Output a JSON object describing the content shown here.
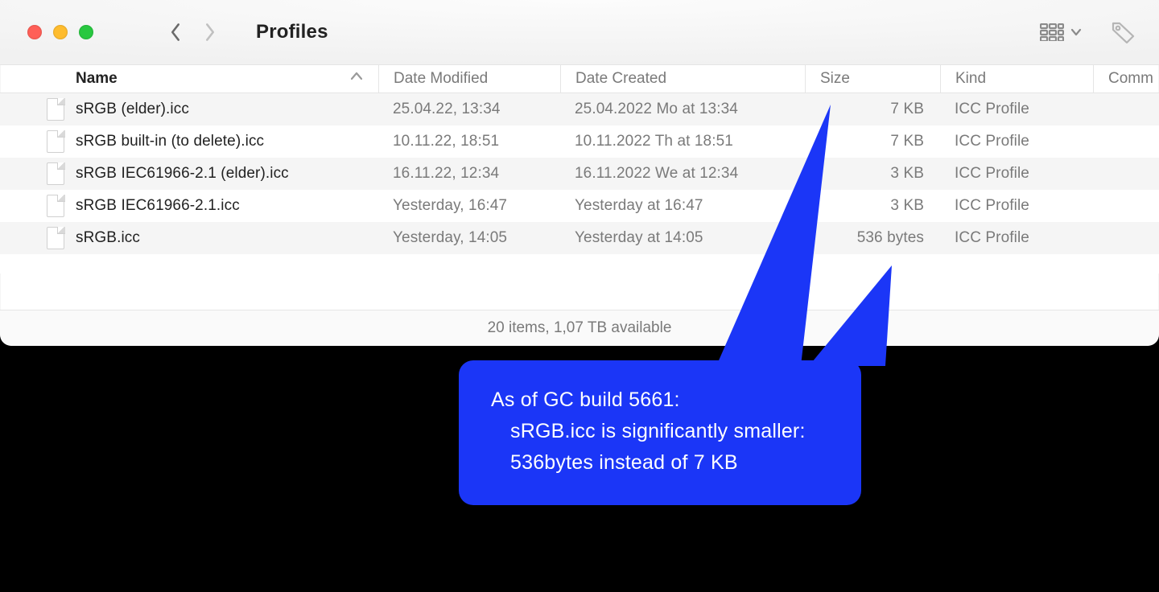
{
  "window": {
    "title": "Profiles"
  },
  "columns": {
    "name": "Name",
    "modified": "Date Modified",
    "created": "Date Created",
    "size": "Size",
    "kind": "Kind",
    "comments": "Comm"
  },
  "rows": [
    {
      "name": "sRGB (elder).icc",
      "modified": "25.04.22, 13:34",
      "created": "25.04.2022 Mo at 13:34",
      "size": "7 KB",
      "kind": "ICC Profile"
    },
    {
      "name": "sRGB built-in (to delete).icc",
      "modified": "10.11.22, 18:51",
      "created": "10.11.2022 Th at 18:51",
      "size": "7 KB",
      "kind": "ICC Profile"
    },
    {
      "name": "sRGB IEC61966-2.1 (elder).icc",
      "modified": "16.11.22, 12:34",
      "created": "16.11.2022 We at 12:34",
      "size": "3 KB",
      "kind": "ICC Profile"
    },
    {
      "name": "sRGB IEC61966-2.1.icc",
      "modified": "Yesterday, 16:47",
      "created": "Yesterday at 16:47",
      "size": "3 KB",
      "kind": "ICC Profile"
    },
    {
      "name": "sRGB.icc",
      "modified": "Yesterday, 14:05",
      "created": "Yesterday at 14:05",
      "size": "536 bytes",
      "kind": "ICC Profile"
    }
  ],
  "status": "20 items, 1,07 TB available",
  "callout": {
    "line1": "As of GC build 5661:",
    "line2": "sRGB.icc is significantly smaller:",
    "line3": "536bytes instead of 7 KB"
  }
}
